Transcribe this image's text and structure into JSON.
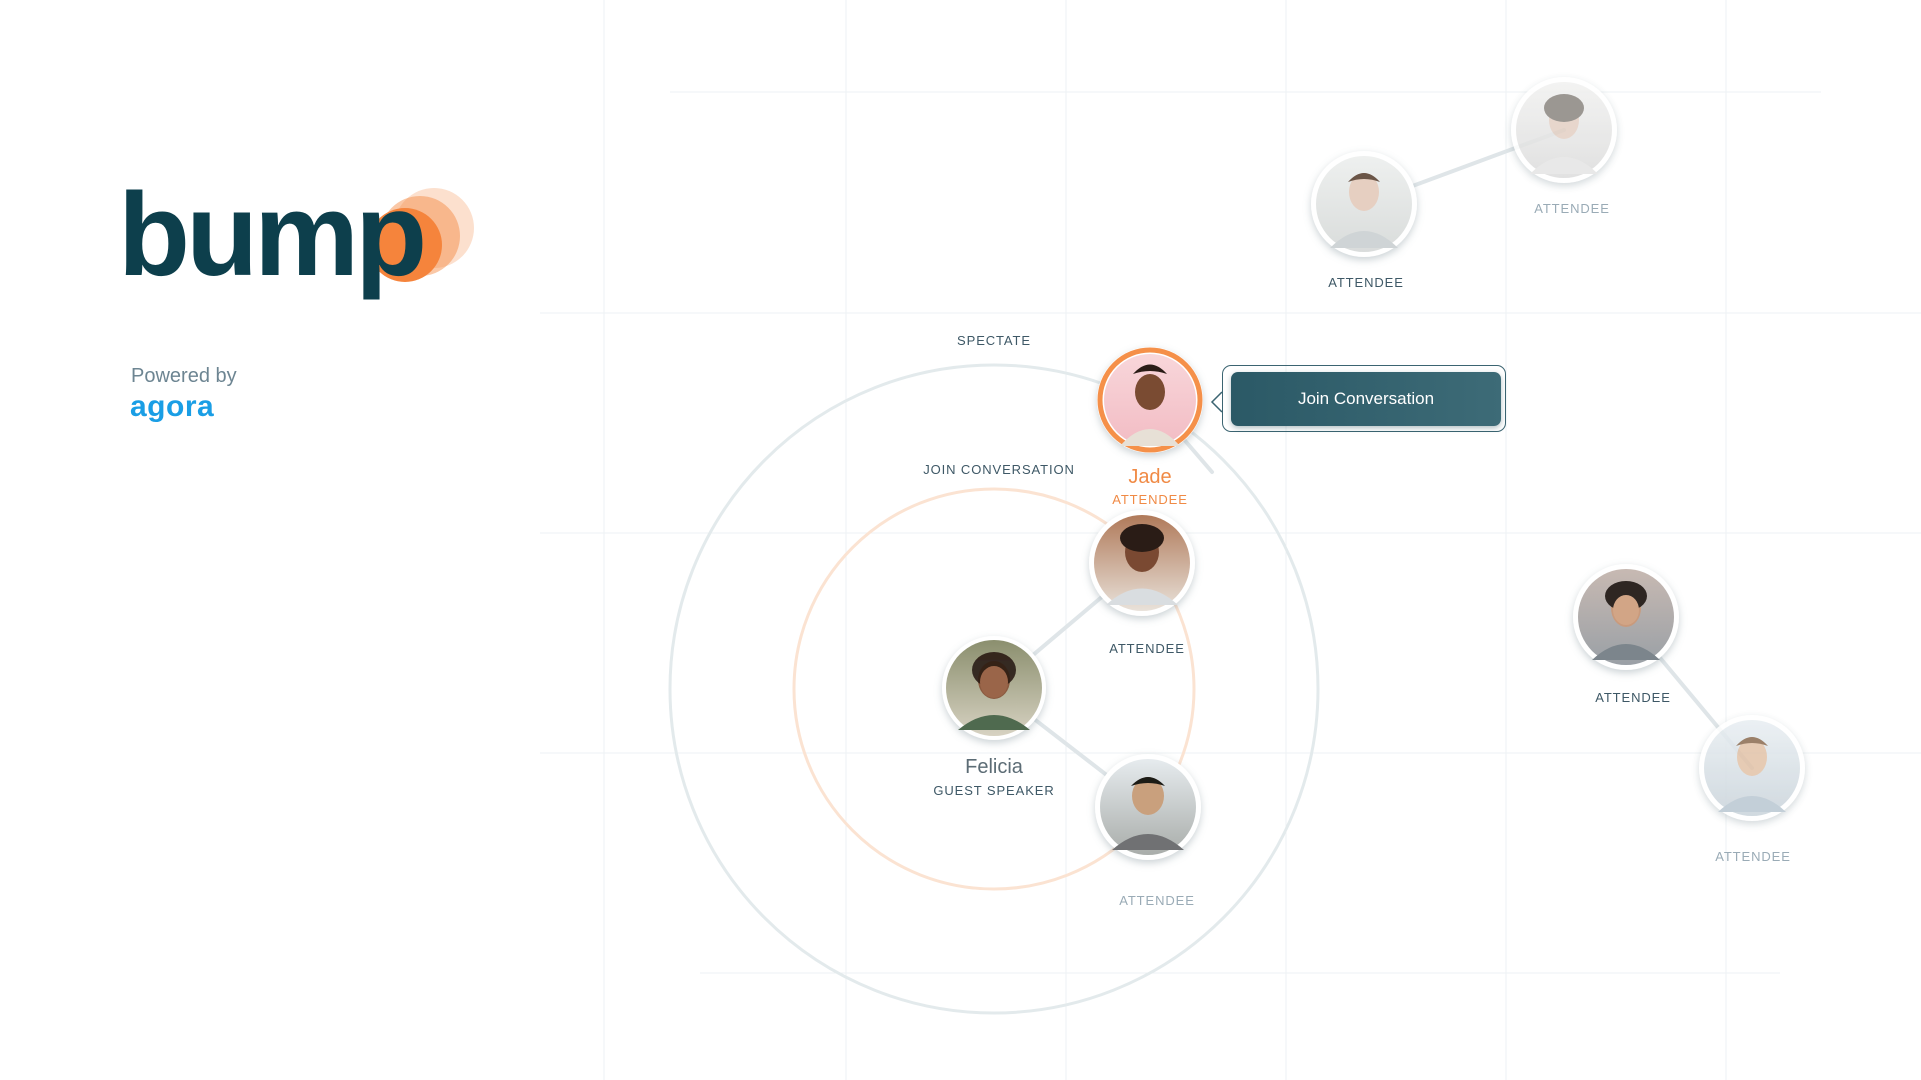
{
  "brand": {
    "logo_text": "bump",
    "powered_by": "Powered by",
    "partner_logo_text": "agora"
  },
  "rings": {
    "outer_label": "SPECTATE",
    "inner_label": "JOIN CONVERSATION"
  },
  "action": {
    "join_button_label": "Join Conversation"
  },
  "people": {
    "jade": {
      "name": "Jade",
      "role": "ATTENDEE"
    },
    "felicia": {
      "name": "Felicia",
      "role": "GUEST SPEAKER"
    },
    "bearded": {
      "role": "ATTENDEE"
    },
    "bottom_center": {
      "role": "ATTENDEE"
    },
    "top_a": {
      "role": "ATTENDEE"
    },
    "top_b": {
      "role": "ATTENDEE"
    },
    "right_a": {
      "role": "ATTENDEE"
    },
    "right_b": {
      "role": "ATTENDEE"
    }
  },
  "colors": {
    "brand_dark": "#0d3f4c",
    "brand_orange": "#f5843c",
    "agora_blue": "#1a9ee5",
    "button_teal": "#2f5d6a"
  }
}
